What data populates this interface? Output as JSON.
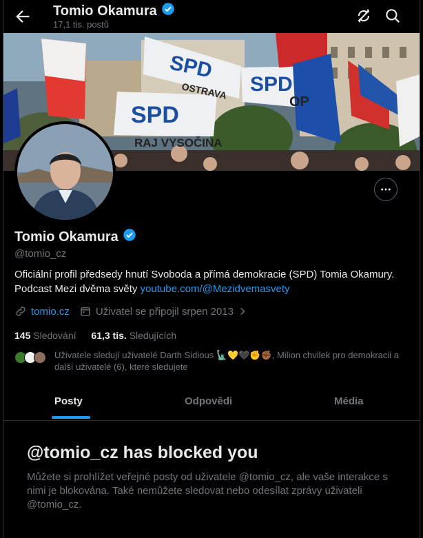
{
  "topbar": {
    "name": "Tomio Okamura",
    "posts_count": "17,1 tis. postů"
  },
  "banner": {
    "flag_texts": [
      "SPD",
      "OSTRAVA",
      "SPD",
      "OP",
      "SPD",
      "RAJ VYSOČINA"
    ]
  },
  "profile": {
    "name": "Tomio Okamura",
    "handle": "@tomio_cz",
    "bio_line1": "Oficiální profil předsedy hnutí Svoboda a přímá demokracie (SPD) Tomia Okamury.",
    "bio_line2_prefix": "Podcast Mezi dvěma světy ",
    "bio_link": "youtube.com/@Mezidvemasvety",
    "website": "tomio.cz",
    "joined": "Uživatel se připojil srpen 2013",
    "following_count": "145",
    "following_label": "Sledování",
    "followers_count": "61,3 tis.",
    "followers_label": "Sledujících",
    "known_followers": "Uživatele sledují uživatelé Darth Sidious 🗽💛🖤✊✊🏾, Milion chvilek pro demokracii a další uživatelé (6), které sledujete"
  },
  "tabs": [
    {
      "label": "Posty",
      "active": true
    },
    {
      "label": "Odpovědi",
      "active": false
    },
    {
      "label": "Média",
      "active": false
    }
  ],
  "blocked": {
    "title": "@tomio_cz has blocked you",
    "text": "Můžete si prohlížet veřejné posty od uživatele @tomio_cz, ale vaše interakce s nimi je blokována. Také nemůžete sledovat nebo odesílat zprávy uživateli @tomio_cz."
  },
  "colors": {
    "accent": "#1d9bf0",
    "background": "#000000",
    "muted": "#71767b",
    "text": "#e7e9ea"
  }
}
